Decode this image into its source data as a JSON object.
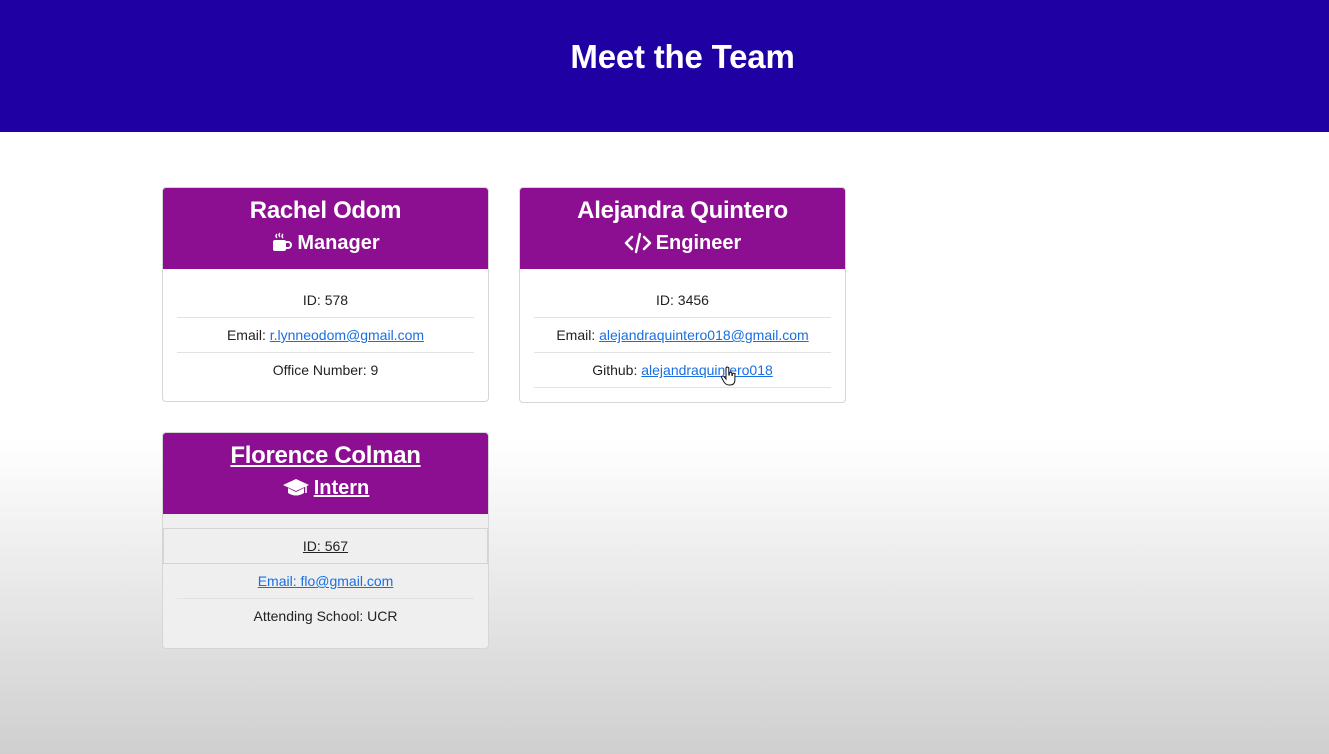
{
  "header": {
    "title": "Meet the Team"
  },
  "cards": [
    {
      "name": "Rachel Odom",
      "role": "Manager",
      "role_icon": "coffee-mug-icon",
      "id_text": "ID: 578",
      "email_label": "Email: ",
      "email": "r.lynneodom@gmail.com",
      "extra_text": "Office Number: 9"
    },
    {
      "name": "Alejandra Quintero",
      "role": "Engineer",
      "role_icon": "code-icon",
      "id_text": "ID: 3456",
      "email_label": "Email: ",
      "email": "alejandraquintero018@gmail.com",
      "extra_label": "Github: ",
      "github": "alejandraquintero018"
    },
    {
      "name": "Florence Colman",
      "role": "Intern",
      "role_icon": "graduation-cap-icon",
      "id_text": "ID: 567",
      "email_text": "Email: flo@gmail.com",
      "extra_text": "Attending School: UCR"
    }
  ],
  "colors": {
    "header_bg": "#1f00a3",
    "card_header_bg": "#8c0f92",
    "link": "#1a6fe0"
  }
}
